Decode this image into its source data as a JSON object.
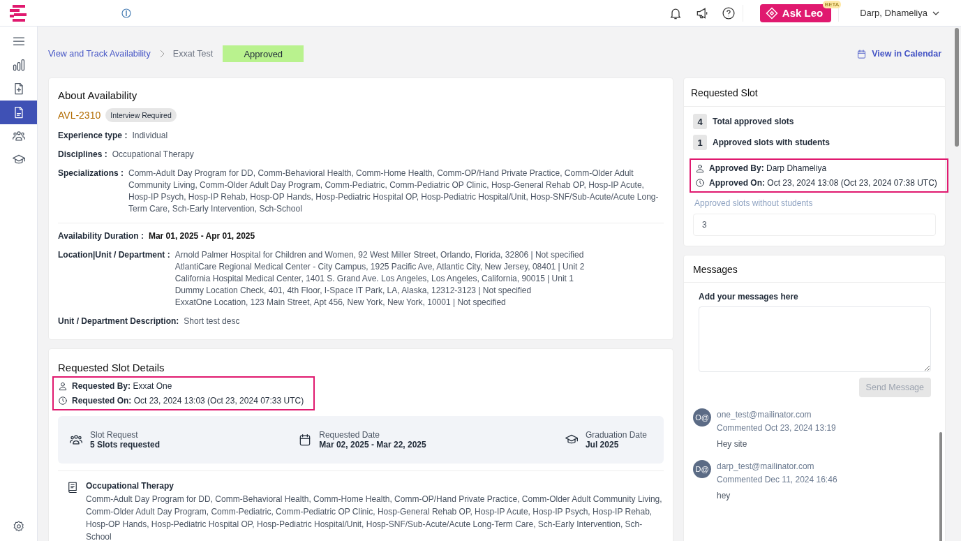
{
  "header": {
    "ask_leo": {
      "label": "Ask Leo",
      "badge": "BETA"
    },
    "user": "Darp, Dhameliya"
  },
  "sidebar": {
    "items": [
      {
        "kind": "menu",
        "selected": false
      },
      {
        "kind": "chart",
        "selected": false
      },
      {
        "kind": "file-add",
        "selected": false
      },
      {
        "kind": "document",
        "selected": true
      },
      {
        "kind": "people",
        "selected": false
      },
      {
        "kind": "cap",
        "selected": false
      }
    ],
    "bottom": [
      {
        "kind": "settings",
        "selected": false
      }
    ]
  },
  "breadcrumb": [
    {
      "label": "View and Track Availability",
      "kind": "link"
    },
    {
      "label": "Exxat Test",
      "kind": "current"
    }
  ],
  "status": "Approved",
  "view_calendar": "View in Calendar",
  "about": {
    "title": "About Availability",
    "id": "AVL-2310",
    "tag": "Interview Required",
    "fields": [
      {
        "label": "Experience type :",
        "kind": "plain",
        "value": "Individual"
      },
      {
        "label": "Disciplines :",
        "kind": "plain",
        "value": "Occupational Therapy"
      },
      {
        "label": "Specializations :",
        "kind": "plain",
        "value": "Comm-Adult Day Program for DD, Comm-Behavioral Health, Comm-Home Health, Comm-OP/Hand Private Practice, Comm-Older Adult Community Living, Comm-Older Adult Day Program, Comm-Pediatric, Comm-Pediatric OP Clinic, Hosp-General Rehab OP, Hosp-IP Acute, Hosp-IP Psych, Hosp-IP Rehab, Hosp-OP Hands, Hosp-Pediatric Hospital OP, Hosp-Pediatric Hospital/Unit, Hosp-SNF/Sub-Acute/Acute Long-Term Care, Sch-Early Intervention, Sch-School"
      },
      {
        "label": "Availability Duration :",
        "kind": "bold",
        "value": "Mar 01, 2025 - Apr 01, 2025",
        "divider_before": true
      },
      {
        "label": "Location|Unit / Department :",
        "kind": "list",
        "values": [
          "Arnold Palmer Hospital for Children and Women, 92 West Miller Street, Orlando, Florida, 32806 | Not specified",
          "AtlantiCare Regional Medical Center - City Campus, 1925 Pacific Ave, Atlantic City, New Jersey, 08401 | Unit 2",
          "California Hospital Medical Center, 1401 S. Grand Ave. Los Angeles, Los Angeles, California, 90015 | Unit 1",
          "Dummy Location Check, 401, 4th Floor, I-Space IT Park, LA, Alaska, 12312-3123 | Not specified",
          "ExxatOne Location, 123 Main Street, Apt 456, New York, New York, 10001 | Not specified"
        ]
      },
      {
        "label": "Unit / Department Description:",
        "kind": "plain",
        "value": "Short test desc"
      }
    ]
  },
  "slot_details": {
    "title": "Requested Slot Details",
    "highlighted": true,
    "meta": [
      {
        "kind": "person",
        "label": "Requested By:",
        "value": "Exxat One"
      },
      {
        "kind": "clock",
        "label": "Requested On:",
        "value": "Oct 23, 2024 13:03 (Oct 23, 2024 07:33 UTC)"
      }
    ],
    "summary": [
      {
        "kind": "people",
        "label": "Slot Request",
        "value": "5 Slots requested"
      },
      {
        "kind": "calendar",
        "label": "Requested Date",
        "value": "Mar 02, 2025 - Mar 22, 2025"
      },
      {
        "kind": "cap",
        "label": "Graduation Date",
        "value": "Jul 2025"
      }
    ],
    "discipline": {
      "title": "Occupational Therapy",
      "text": "Comm-Adult Day Program for DD, Comm-Behavioral Health, Comm-Home Health, Comm-OP/Hand Private Practice, Comm-Older Adult Community Living, Comm-Older Adult Day Program, Comm-Pediatric, Comm-Pediatric OP Clinic, Hosp-General Rehab OP, Hosp-IP Acute, Hosp-IP Psych, Hosp-IP Rehab, Hosp-OP Hands, Hosp-Pediatric Hospital OP, Hosp-Pediatric Hospital/Unit, Hosp-SNF/Sub-Acute/Acute Long-Term Care, Sch-Early Intervention, Sch-School"
    }
  },
  "requested_slot": {
    "title": "Requested Slot",
    "stats": [
      {
        "count": "4",
        "label": "Total approved slots"
      },
      {
        "count": "1",
        "label": "Approved slots with students"
      }
    ],
    "highlighted": true,
    "meta": [
      {
        "kind": "person",
        "label": "Approved By:",
        "value": "Darp Dhameliya"
      },
      {
        "kind": "clock",
        "label": "Approved On:",
        "value": "Oct 23, 2024 13:08 (Oct 23, 2024 07:38 UTC)"
      }
    ],
    "without_students": {
      "label": "Approved slots without students",
      "value": "3"
    }
  },
  "messages": {
    "title": "Messages",
    "input_label": "Add your messages here",
    "send_button": {
      "label": "Send Message",
      "disabled": true
    },
    "comments": [
      {
        "avatar": "O@",
        "author": "one_test@mailinator.com",
        "meta": "Commented Oct 23, 2024 13:19",
        "text": "Hey site"
      },
      {
        "avatar": "D@",
        "author": "darp_test@mailinator.com",
        "meta": "Commented Dec 11, 2024 16:46",
        "text": "hey"
      }
    ]
  }
}
